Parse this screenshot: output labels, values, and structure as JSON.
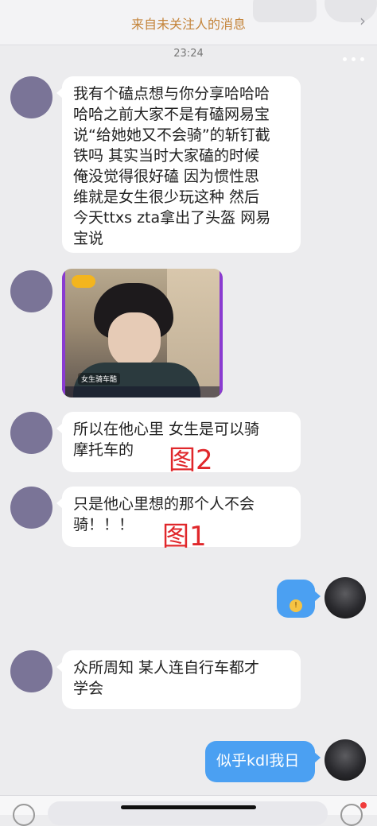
{
  "header": {
    "title": "来自未关注人的消息",
    "chevron_icon": "chevron-right-icon",
    "more_icon": "more-dots-icon"
  },
  "timestamp": "23:24",
  "messages": [
    {
      "side": "left",
      "text": "我有个磕点想与你分享哈哈哈\n哈哈之前大家不是有磕网易宝\n说“给她她又不会骑”的斩钉截\n铁吗 其实当时大家磕的时候\n俺没觉得很好磕 因为惯性思\n维就是女生很少玩这种 然后\n今天ttxs zta拿出了头盔 网易\n宝说"
    },
    {
      "side": "left",
      "type": "image",
      "caption": "女生骑车酷"
    },
    {
      "side": "left",
      "text": "所以在他心里 女生是可以骑\n摩托车的"
    },
    {
      "side": "left",
      "text": "只是他心里想的那个人不会\n骑！！！"
    },
    {
      "side": "right",
      "type": "emoji",
      "emoji_icon": "surprised-emoji-icon"
    },
    {
      "side": "left",
      "text": "众所周知 某人连自行车都才\n学会"
    },
    {
      "side": "right",
      "text": "似乎kdl我日"
    }
  ],
  "annotations": {
    "fig2": "图2",
    "fig1": "图1"
  },
  "colors": {
    "header_title": "#c4843a",
    "my_bubble": "#4ba0f2",
    "annotation": "#e0272b"
  }
}
